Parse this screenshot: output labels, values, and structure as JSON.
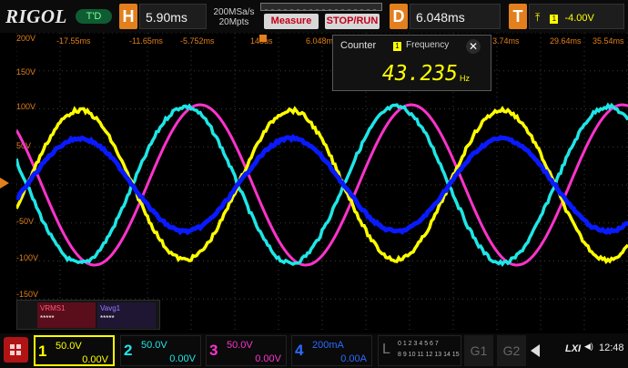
{
  "app": {
    "logo": "RIGOL",
    "mode_badge": "T'D"
  },
  "horizontal": {
    "letter": "H",
    "timebase": "5.90ms",
    "sample_rate": "200MSa/s",
    "memory_depth": "20Mpts"
  },
  "buttons": {
    "measure": "Measure",
    "run_stop": "STOP/RUN"
  },
  "delay": {
    "letter": "D",
    "value": "6.048ms"
  },
  "trigger": {
    "letter": "T",
    "channel": "1",
    "level": "-4.00V"
  },
  "time_axis": [
    "-17.55ms",
    "-11.65ms",
    "-5.752ms",
    "148us",
    "6.048ms",
    "3.74ms",
    "29.64ms",
    "35.54ms"
  ],
  "volt_axis": [
    "200V",
    "150V",
    "100V",
    "50V",
    "0",
    "-50V",
    "-100V",
    "-150V"
  ],
  "counter": {
    "title": "Counter",
    "channel": "1",
    "label": "Frequency",
    "value": "43.235",
    "unit": "Hz"
  },
  "measurements": [
    {
      "name": "VRMS1",
      "value": "*****",
      "color": "#b21a3a"
    },
    {
      "name": "Vavg1",
      "value": "*****",
      "color": "#7b5cff"
    }
  ],
  "channels": [
    {
      "num": "1",
      "scale": "50.0V",
      "offset": "0.00V",
      "color": "#ffff00"
    },
    {
      "num": "2",
      "scale": "50.0V",
      "offset": "0.00V",
      "color": "#1fe6e6"
    },
    {
      "num": "3",
      "scale": "50.0V",
      "offset": "0.00V",
      "color": "#ff33cc"
    },
    {
      "num": "4",
      "scale": "200mA",
      "offset": "0.00A",
      "color": "#2b6bff"
    }
  ],
  "logic": {
    "letter": "L",
    "row1": "0 1 2 3 4 5 6 7",
    "row2": "8 9 10 11 12 13 14 15"
  },
  "gen": [
    "G1",
    "G2"
  ],
  "status": {
    "lxi": "LXI",
    "time": "12:48"
  },
  "colors": {
    "accent": "#e37f1d",
    "ch1": "#ffff00",
    "ch2": "#1fe6e6",
    "ch3": "#ff33cc",
    "ch4": "#0a1aff"
  }
}
